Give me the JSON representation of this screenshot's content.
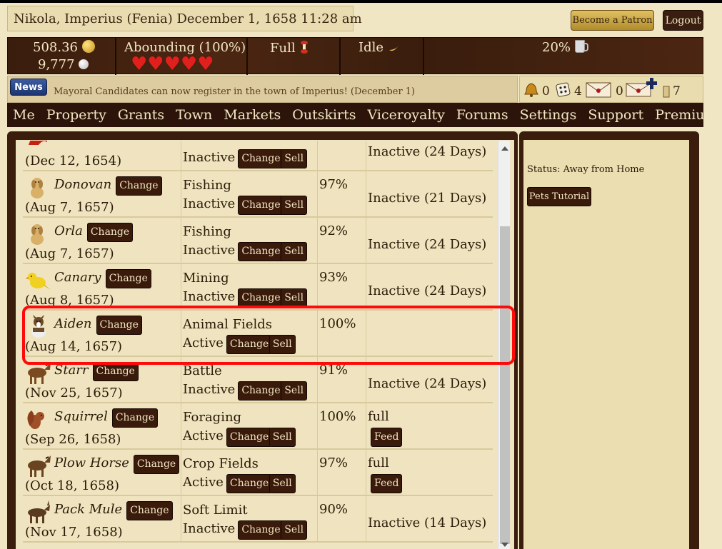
{
  "header": {
    "title": "Nikola, Imperius (Fenia)  December 1, 1658 11:28 am",
    "patron_label": "Become a Patron",
    "logout_label": "Logout"
  },
  "stats": {
    "money": "508.36",
    "pearls": "9,777",
    "health": "Abounding (100%)",
    "hearts": "♥♥♥♥♥",
    "food": "Full",
    "activity": "Idle",
    "drink": "20%"
  },
  "news": {
    "badge": "News",
    "text": "Mayoral Candidates can now register in the town of Imperius! (December 1)"
  },
  "notifications": {
    "bells": "0",
    "dice": "4",
    "mail": "0",
    "new_mail": "",
    "scrolls": "7"
  },
  "nav": [
    "Me",
    "Property",
    "Grants",
    "Town",
    "Markets",
    "Outskirts",
    "Viceroyalty",
    "Forums",
    "Settings",
    "Support",
    "Premium"
  ],
  "buttons": {
    "change": "Change",
    "sell": "Sell",
    "feed": "Feed"
  },
  "pets": [
    {
      "name": "",
      "date": "(Dec 12, 1654)",
      "job": "",
      "status": "Inactive",
      "pct": "",
      "condition": "Inactive (24 Days)",
      "icon": "dragon-icon",
      "color": "#c82010"
    },
    {
      "name": "Donovan",
      "date": "(Aug 7, 1657)",
      "job": "Fishing",
      "status": "Inactive",
      "pct": "97%",
      "condition": "Inactive (21 Days)",
      "icon": "dog-icon",
      "color": "#d8b068"
    },
    {
      "name": "Orla",
      "date": "(Aug 7, 1657)",
      "job": "Fishing",
      "status": "Inactive",
      "pct": "92%",
      "condition": "Inactive (24 Days)",
      "icon": "dog-icon",
      "color": "#d8b068"
    },
    {
      "name": "Canary",
      "date": "(Aug 8, 1657)",
      "job": "Mining",
      "status": "Inactive",
      "pct": "93%",
      "condition": "Inactive (24 Days)",
      "icon": "canary-icon",
      "color": "#f0d020"
    },
    {
      "name": "Aiden",
      "date": "(Aug 14, 1657)",
      "job": "Animal Fields",
      "status": "Active",
      "pct": "100%",
      "condition": "",
      "icon": "sheepdog-icon",
      "color": "#6b4a2a"
    },
    {
      "name": "Starr",
      "date": "(Nov 25, 1657)",
      "job": "Battle",
      "status": "Inactive",
      "pct": "91%",
      "condition": "Inactive (24 Days)",
      "icon": "horse-icon",
      "color": "#7a4a20"
    },
    {
      "name": "Squirrel",
      "date": "(Sep 26, 1658)",
      "job": "Foraging",
      "status": "Active",
      "pct": "100%",
      "condition": "full",
      "feed": true,
      "icon": "squirrel-icon",
      "color": "#a05028"
    },
    {
      "name": "Plow Horse",
      "date": "(Oct 18, 1658)",
      "job": "Crop Fields",
      "status": "Active",
      "pct": "97%",
      "condition": "full",
      "feed": true,
      "icon": "horse-icon",
      "color": "#6a4420"
    },
    {
      "name": "Pack Mule",
      "date": "(Nov 17, 1658)",
      "job": "Soft Limit",
      "status": "Inactive",
      "pct": "90%",
      "condition": "Inactive (14 Days)",
      "icon": "mule-icon",
      "color": "#5a3a20"
    }
  ],
  "side": {
    "status": "Status: Away from Home",
    "tutorial_label": "Pets Tutorial"
  }
}
